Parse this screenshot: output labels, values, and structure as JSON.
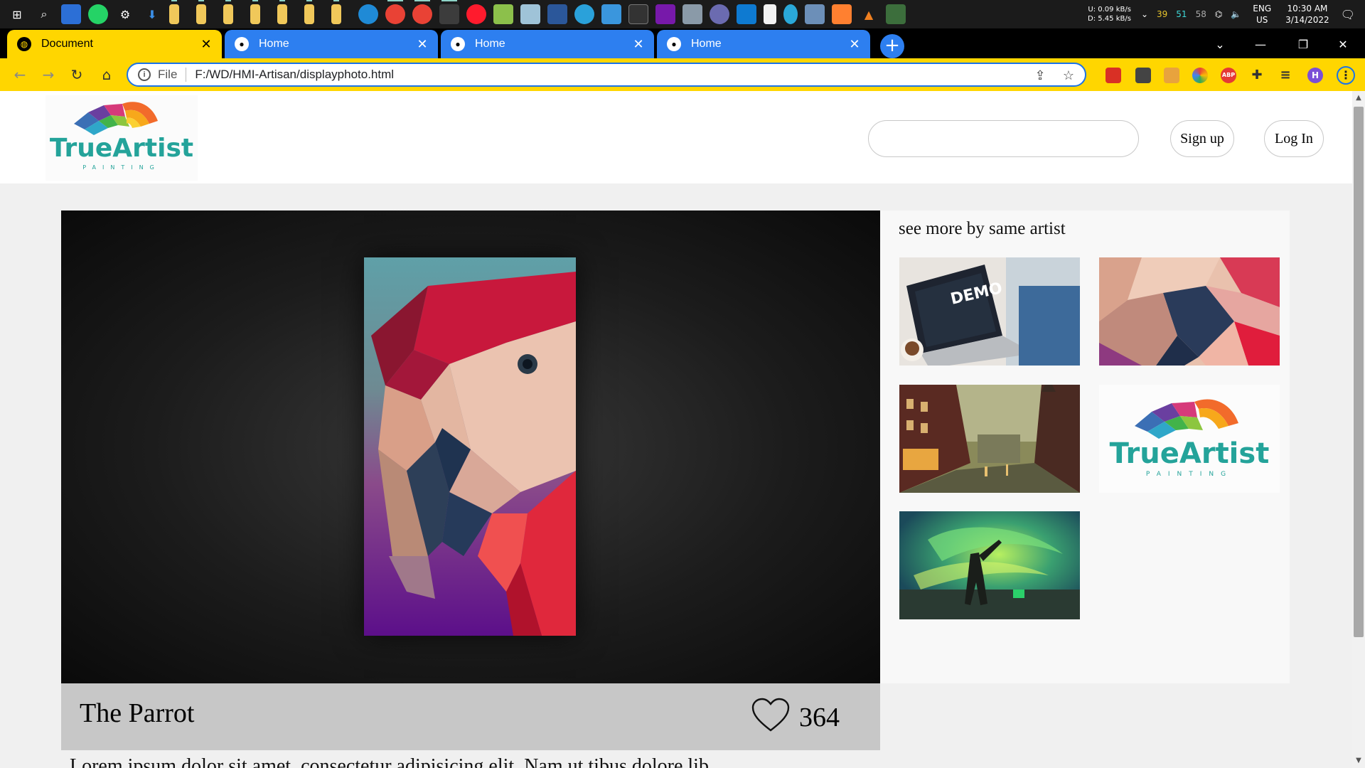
{
  "taskbar": {
    "network": {
      "up": "0.09 kB/s",
      "down": "5.45 kB/s",
      "u_label": "U:",
      "d_label": "D:"
    },
    "counters": [
      "39",
      "51",
      "58"
    ],
    "language": {
      "lang": "ENG",
      "region": "US"
    },
    "clock": {
      "time": "10:30 AM",
      "date": "3/14/2022"
    }
  },
  "browser": {
    "tabs": [
      {
        "title": "Document",
        "active": true
      },
      {
        "title": "Home",
        "active": false
      },
      {
        "title": "Home",
        "active": false
      },
      {
        "title": "Home",
        "active": false
      }
    ],
    "close_glyph": "✕",
    "new_tab_glyph": "+",
    "address": {
      "scheme_label": "File",
      "url": "F:/WD/HMI-Artisan/displayphoto.html"
    },
    "profile_initial": "H",
    "ext_abp": "ABP"
  },
  "site": {
    "logo": {
      "brand": "TrueArtist",
      "tagline": "PAINTING"
    },
    "search": {
      "placeholder": ""
    },
    "signup_label": "Sign up",
    "login_label": "Log In"
  },
  "artwork": {
    "title": "The Parrot",
    "likes": "364",
    "description": "Lorem ipsum dolor sit amet, consectetur adipisicing elit. Nam ut tibus dolore lib"
  },
  "sidebar": {
    "title": "see more by same artist",
    "thumbnails": [
      {
        "name": "demo-laptop",
        "label": "DEMO"
      },
      {
        "name": "parrot-closeup",
        "label": ""
      },
      {
        "name": "city-street",
        "label": ""
      },
      {
        "name": "truartist-logo",
        "label": "TrueArtist"
      },
      {
        "name": "green-smoke-figure",
        "label": ""
      }
    ]
  },
  "colors": {
    "active_tab": "#ffd600",
    "inactive_tab": "#2d7ff0",
    "toolbar": "#ffd600",
    "info_bar": "#c7c7c7"
  }
}
